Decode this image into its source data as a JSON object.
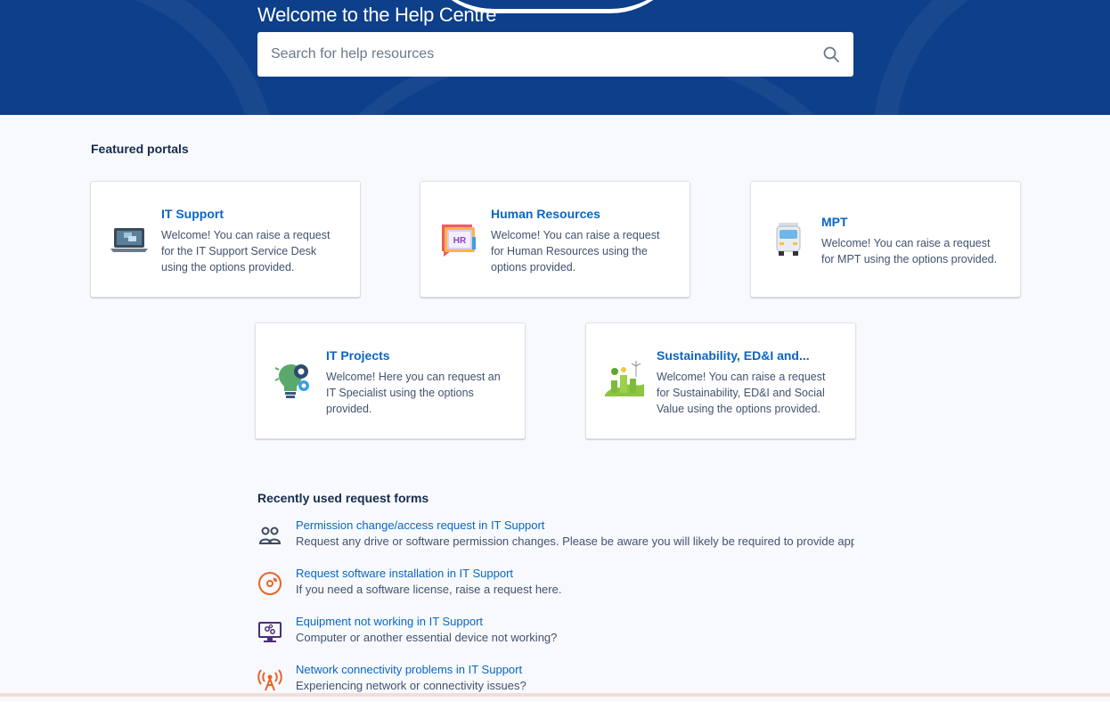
{
  "header": {
    "title": "Welcome to the Help Centre",
    "search_placeholder": "Search for help resources"
  },
  "featured": {
    "heading": "Featured portals",
    "portals": [
      {
        "title": "IT Support",
        "description": "Welcome! You can raise a request for the IT Support Service Desk using the options provided.",
        "icon": "laptop-icon"
      },
      {
        "title": "Human Resources",
        "description": "Welcome! You can raise a request for Human Resources using the options provided.",
        "icon": "hr-chat-icon",
        "icon_text": "HR"
      },
      {
        "title": "MPT",
        "description": "Welcome! You can raise a request for MPT using the options provided.",
        "icon": "truck-icon"
      },
      {
        "title": "IT Projects",
        "description": "Welcome! Here you can request an IT Specialist using the options provided.",
        "icon": "lightbulb-gear-icon"
      },
      {
        "title": "Sustainability, ED&I and...",
        "description": "Welcome! You can raise a request for Sustainability, ED&I and Social Value using the options provided.",
        "icon": "green-city-icon"
      }
    ]
  },
  "recent": {
    "heading": "Recently used request forms",
    "items": [
      {
        "title": "Permission change/access request in IT Support",
        "description": "Request any drive or software permission changes. Please be aware you will likely be required to provide approval",
        "icon": "users-icon"
      },
      {
        "title": "Request software installation in IT Support",
        "description": "If you need a software license, raise a request here.",
        "icon": "disc-icon"
      },
      {
        "title": "Equipment not working in IT Support",
        "description": "Computer or another essential device not working?",
        "icon": "monitor-icon"
      },
      {
        "title": "Network connectivity problems in IT Support",
        "description": "Experiencing network or connectivity issues?",
        "icon": "antenna-icon"
      }
    ]
  },
  "colors": {
    "hero": "#0d3f8a",
    "link": "#0b66c3",
    "background": "#f7f9fc"
  }
}
